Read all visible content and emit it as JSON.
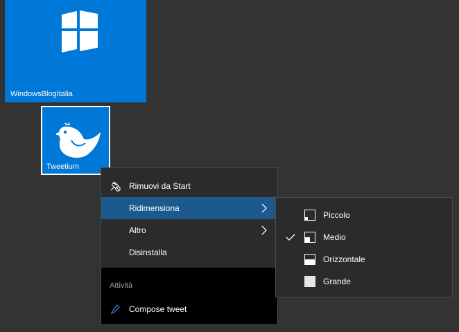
{
  "tiles": [
    {
      "label": "WindowsBlogItalia",
      "icon": "windows-logo-icon",
      "color": "#0078d7"
    },
    {
      "label": "Tweetium",
      "icon": "bird-icon",
      "color": "#0078d7"
    }
  ],
  "context_menu": {
    "items": [
      {
        "label": "Rimuovi da Start",
        "icon": "unpin-icon"
      },
      {
        "label": "Ridimensiona",
        "has_submenu": true,
        "selected": true
      },
      {
        "label": "Altro",
        "has_submenu": true
      },
      {
        "label": "Disinstalla"
      }
    ],
    "section_header": "Attività",
    "tasks": [
      {
        "label": "Compose tweet",
        "icon": "pencil-icon"
      }
    ],
    "highlight_color": "#1c5a8e"
  },
  "resize_submenu": {
    "items": [
      {
        "label": "Piccolo",
        "icon": "size-small-icon",
        "checked": false
      },
      {
        "label": "Medio",
        "icon": "size-medium-icon",
        "checked": true
      },
      {
        "label": "Orizzontale",
        "icon": "size-wide-icon",
        "checked": false
      },
      {
        "label": "Grande",
        "icon": "size-large-icon",
        "checked": false
      }
    ]
  }
}
